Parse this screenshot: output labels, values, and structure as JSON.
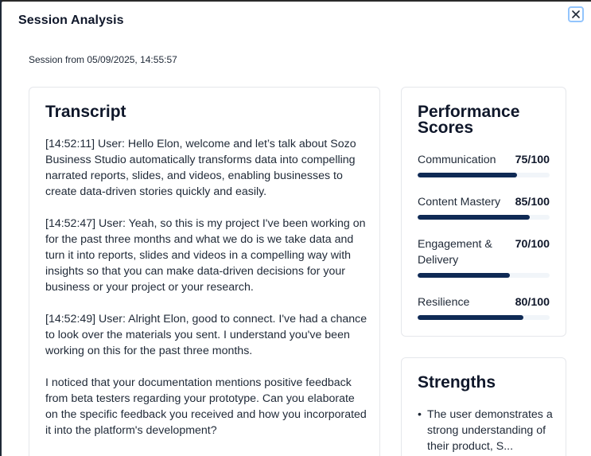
{
  "modal": {
    "title": "Session Analysis",
    "close_icon": "close-icon",
    "session_line": "Session from 05/09/2025, 14:55:57"
  },
  "transcript": {
    "title": "Transcript",
    "entries": [
      "[14:52:11] User: Hello Elon, welcome and let’s talk about Sozo Business Studio automatically transforms data into compelling narrated reports, slides, and videos, enabling businesses to create data-driven stories quickly and easily.",
      "[14:52:47] User: Yeah, so this is my project I've been working on for the past three months and what we do is we take data and turn it into reports, slides and videos in a compelling way with insights so that you can make data-driven decisions for your business or your project or your research.",
      "[14:52:49] User: Alright Elon, good to connect. I've had a chance to look over the materials you sent. I understand you've been working on this for the past three months.",
      "I noticed that your documentation mentions positive feedback from beta testers regarding your prototype. Can you elaborate on the specific feedback you received and how you incorporated it into the platform's development?"
    ]
  },
  "scores": {
    "title": "Performance Scores",
    "items": [
      {
        "name": "Communication",
        "value": "75/100",
        "fraction": 0.75
      },
      {
        "name": "Content Mastery",
        "value": "85/100",
        "fraction": 0.85
      },
      {
        "name": "Engagement & Delivery",
        "value": "70/100",
        "fraction": 0.7
      },
      {
        "name": "Resilience",
        "value": "80/100",
        "fraction": 0.8
      }
    ],
    "bar_color": "#0f2a55"
  },
  "strengths": {
    "title": "Strengths",
    "items": [
      "The user demonstrates a strong understanding of their product, S..."
    ]
  }
}
